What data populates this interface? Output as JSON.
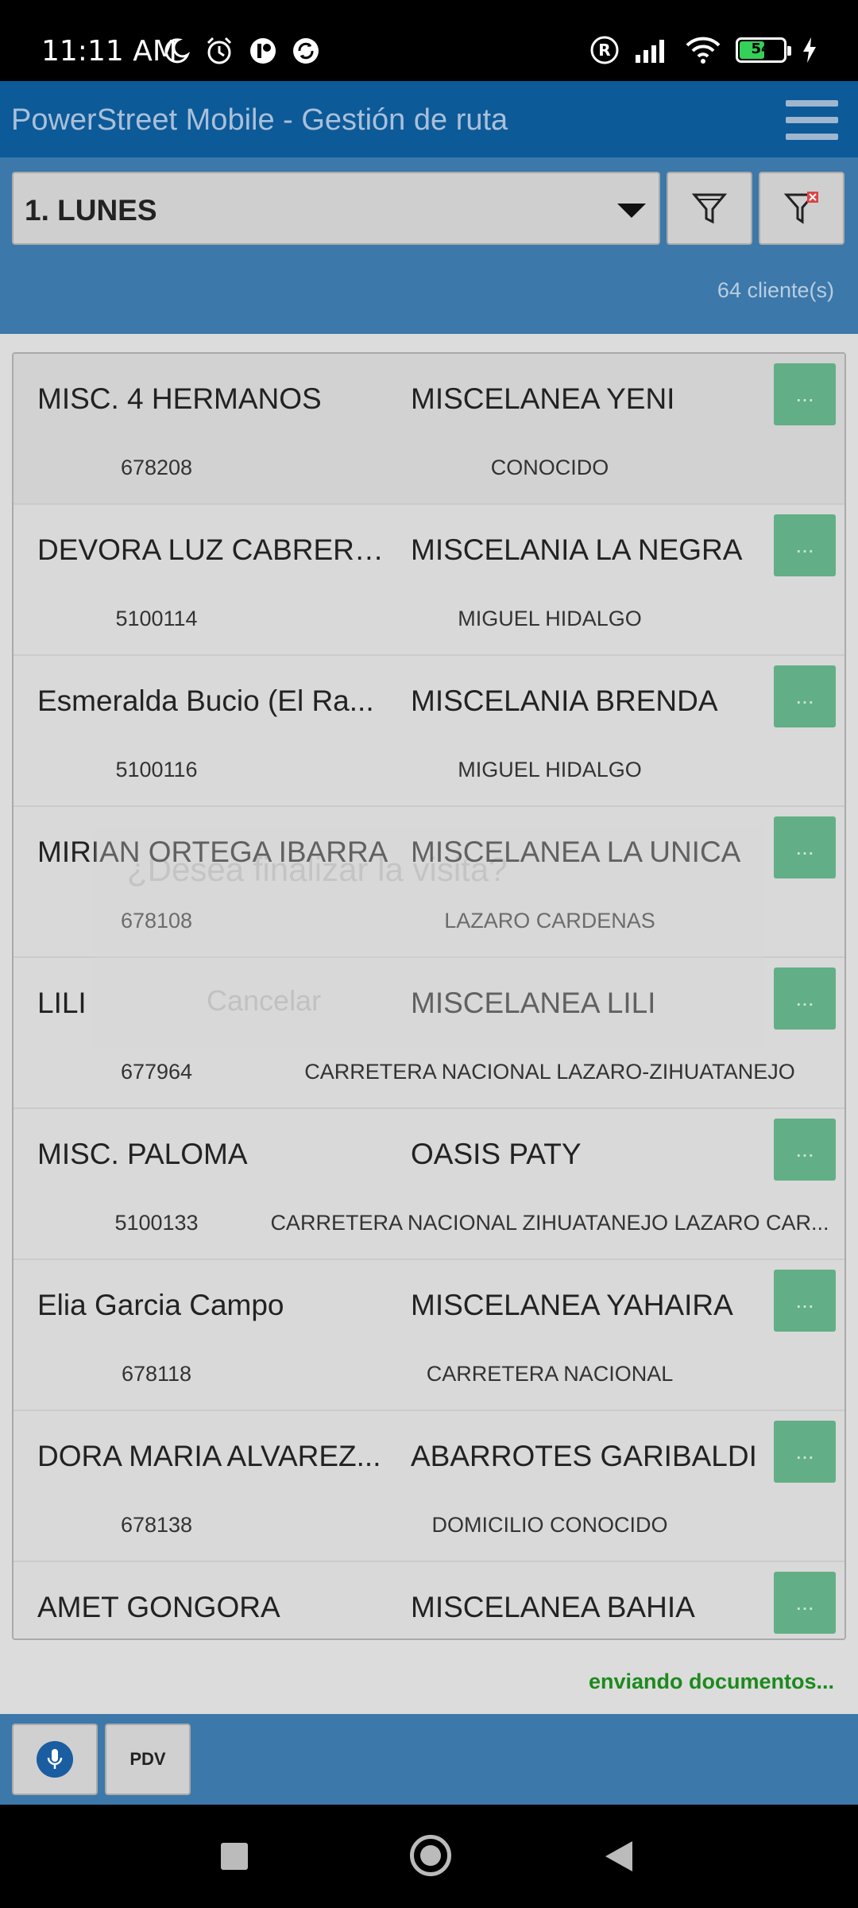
{
  "status_bar": {
    "time": "11:11 AM",
    "battery": "54",
    "battery_fraction": 0.54,
    "icons": [
      "moon-icon",
      "alarm-icon",
      "app-notif-icon",
      "sync-icon",
      "registered-icon",
      "signal-icon",
      "wifi-icon",
      "battery-icon",
      "charging-icon"
    ]
  },
  "app_bar": {
    "title": "PowerStreet Mobile - Gestión de ruta"
  },
  "filters": {
    "day_selected": "1.  LUNES",
    "client_count": "64 cliente(s)"
  },
  "clients": [
    {
      "name": "MISC. 4 HERMANOS",
      "store": "MISCELANEA YENI",
      "code": "678208",
      "address": "CONOCIDO",
      "action": "..."
    },
    {
      "name": "DEVORA LUZ CABRERA...",
      "store": "MISCELANIA LA NEGRA",
      "code": "5100114",
      "address": "MIGUEL HIDALGO",
      "action": "..."
    },
    {
      "name": "Esmeralda Bucio (El Ra...",
      "store": "MISCELANIA BRENDA",
      "code": "5100116",
      "address": "MIGUEL HIDALGO",
      "action": "..."
    },
    {
      "name": "MIRIAN ORTEGA IBARRA",
      "store": "MISCELANEA LA UNICA",
      "code": "678108",
      "address": "LAZARO CARDENAS",
      "action": "..."
    },
    {
      "name": "LILI",
      "store": "MISCELANEA LILI",
      "code": "677964",
      "address": "CARRETERA NACIONAL LAZARO-ZIHUATANEJO",
      "action": "..."
    },
    {
      "name": "MISC. PALOMA",
      "store": "OASIS  PATY",
      "code": "5100133",
      "address": "CARRETERA NACIONAL ZIHUATANEJO LAZARO CAR...",
      "action": "..."
    },
    {
      "name": "Elia Garcia Campo",
      "store": "MISCELANEA YAHAIRA",
      "code": "678118",
      "address": "CARRETERA NACIONAL",
      "action": "..."
    },
    {
      "name": "DORA MARIA ALVAREZ...",
      "store": "ABARROTES GARIBALDI",
      "code": "678138",
      "address": "DOMICILIO CONOCIDO",
      "action": "..."
    },
    {
      "name": "AMET GONGORA",
      "store": "MISCELANEA BAHIA",
      "code": "",
      "address": "",
      "action": "..."
    }
  ],
  "dialog_ghost": {
    "question": "¿Desea finalizar la visita?",
    "cancel": "Cancelar"
  },
  "status_message": "enviando documentos...",
  "toolbar": {
    "pdv_label": "PDV"
  },
  "colors": {
    "app_bar": "#0d5a98",
    "panel": "#3c78aa",
    "action_button": "#62ae86",
    "status_text": "#1c8a1c"
  }
}
